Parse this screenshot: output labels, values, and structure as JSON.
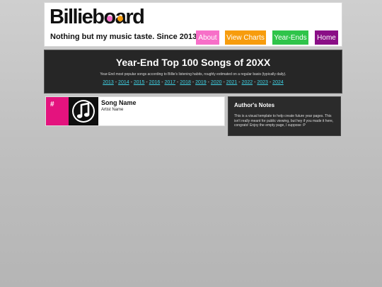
{
  "header": {
    "logo_text": [
      "B",
      "i",
      "l",
      "l",
      "i",
      "e",
      "b",
      "o",
      "a",
      "r",
      "d"
    ],
    "logo_colors": [
      "#f76fc8",
      "#f79c0d"
    ],
    "tagline": "Nothing but my music taste. Since 2013.",
    "nav": {
      "about": "About",
      "view_charts": "View Charts",
      "year_ends": "Year-Ends",
      "home": "Home"
    },
    "nav_colors": {
      "about": "#f76fc8",
      "view_charts": "#f79c0d",
      "year_ends": "#2fc44a",
      "home": "#8a0f86"
    }
  },
  "banner": {
    "title": "Year-End Top 100 Songs of 20XX",
    "subtitle": "Year-End most popular songs according to Billie's listening habits, roughly estimated on a regular basis (typically daily).",
    "years": [
      "2013",
      "2014",
      "2015",
      "2016",
      "2017",
      "2018",
      "2019",
      "2020",
      "2021",
      "2022",
      "2023",
      "2024"
    ]
  },
  "entry": {
    "rank": "#",
    "song": "Song Name",
    "artist": "Artist Name",
    "icon": "music-note-icon",
    "accent": "#e4137e"
  },
  "notes": {
    "title": "Author's Notes",
    "body": "This is a visual template to help create future year pages. This isn't really meant for public viewing, but hey if you made it here, congrats! Enjoy the empty page, I suppose :P"
  }
}
